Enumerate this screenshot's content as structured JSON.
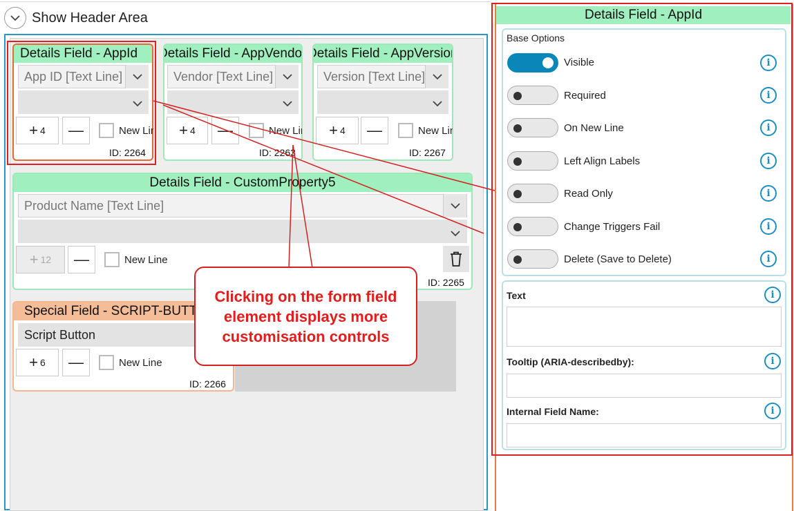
{
  "header": {
    "toggle_label": "Show Header Area"
  },
  "cards": {
    "appid": {
      "title": "Details Field - AppId",
      "field": "App ID [Text Line]",
      "width_value": "4",
      "newline": "New Lin",
      "id": "ID: 2264"
    },
    "appvendor": {
      "title": "Details Field - AppVendor",
      "field": "Vendor [Text Line]",
      "width_value": "4",
      "newline": "New Lin",
      "id": "ID: 2263"
    },
    "appversion": {
      "title": "Details Field - AppVersion",
      "field": "Version [Text Line]",
      "width_value": "4",
      "newline": "New Lin",
      "id": "ID: 2267"
    },
    "custom5": {
      "title": "Details Field - CustomProperty5",
      "field": "Product Name [Text Line]",
      "width_value": "12",
      "newline": "New Line",
      "id": "ID: 2265"
    },
    "special": {
      "title": "Special Field -  SCRIPT-BUTTON",
      "field": "Script Button",
      "width_value": "6",
      "newline": "New Line",
      "id": "ID: 2266"
    }
  },
  "callout": {
    "text": "Clicking on the form field element displays more customisation controls"
  },
  "panel": {
    "title": "Details Field - AppId",
    "base_options_title": "Base Options",
    "options": [
      {
        "label": "Visible",
        "on": true
      },
      {
        "label": "Required",
        "on": false
      },
      {
        "label": "On New Line",
        "on": false
      },
      {
        "label": "Left Align Labels",
        "on": false
      },
      {
        "label": "Read Only",
        "on": false
      },
      {
        "label": "Change Triggers Fail",
        "on": false
      },
      {
        "label": "Delete (Save to Delete)",
        "on": false
      }
    ],
    "text_label": "Text",
    "tooltip_label": "Tooltip (ARIA-describedby):",
    "internal_name_label": "Internal Field Name:"
  },
  "colors": {
    "accent": "#0b86b8",
    "header_green": "#9fefbf",
    "special_orange": "#f5bc98",
    "callout_red": "#e31c1c"
  },
  "icons": {
    "chevron": "chevron-down-icon",
    "plus": "plus-icon",
    "minus": "minus-icon",
    "trash": "trash-icon",
    "info": "info-icon"
  }
}
